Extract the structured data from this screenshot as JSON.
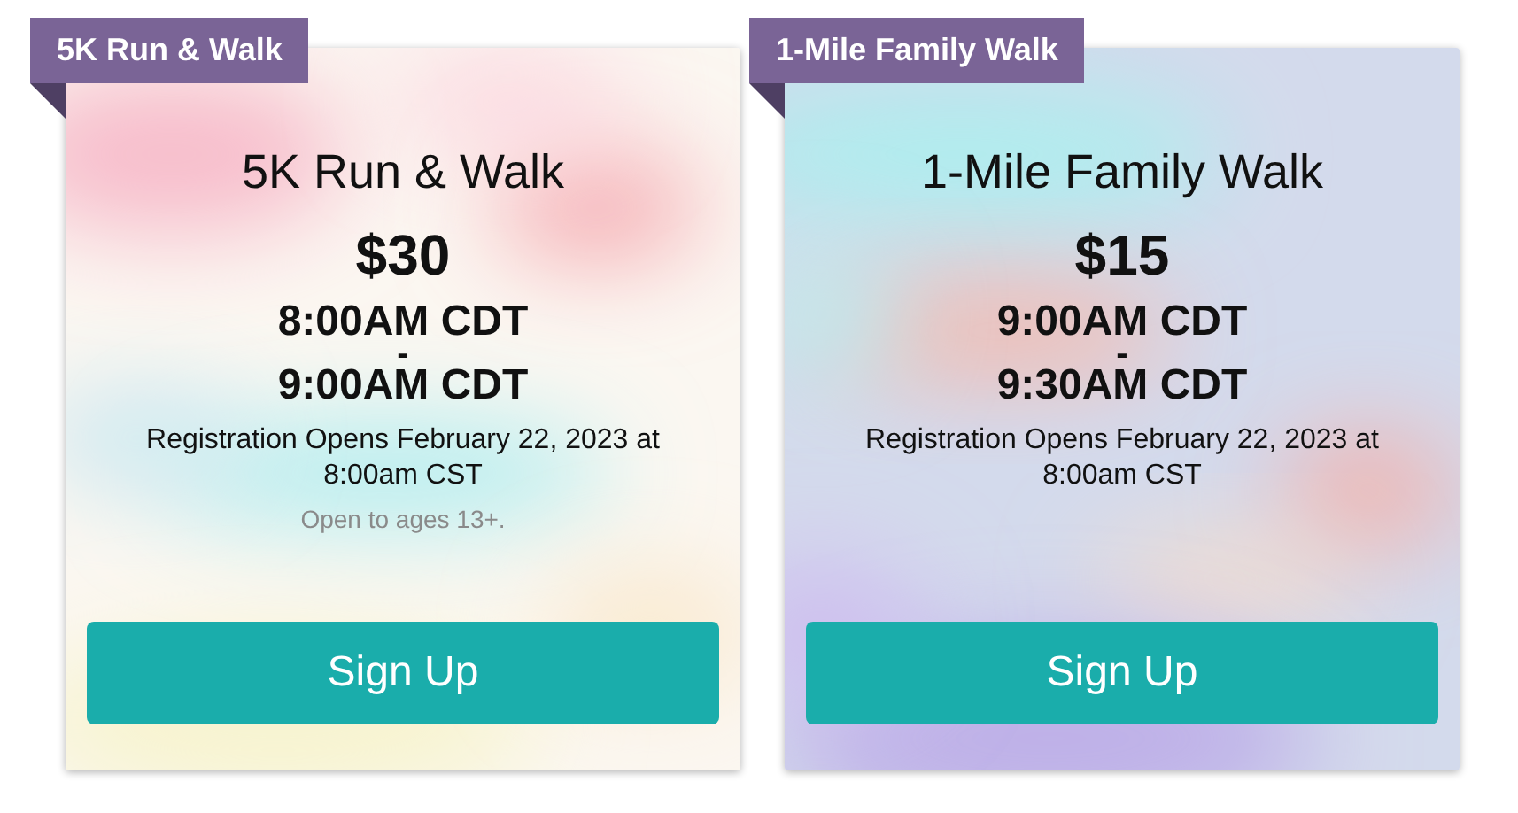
{
  "events": [
    {
      "tag": "5K Run & Walk",
      "title": "5K Run & Walk",
      "price": "$30",
      "start_time": "8:00AM CDT",
      "separator": "-",
      "end_time": "9:00AM CDT",
      "registration": "Registration Opens February 22, 2023 at 8:00am CST",
      "note": "Open to ages 13+.",
      "button": "Sign Up"
    },
    {
      "tag": "1-Mile Family Walk",
      "title": "1-Mile Family Walk",
      "price": "$15",
      "start_time": "9:00AM CDT",
      "separator": "-",
      "end_time": "9:30AM CDT",
      "registration": "Registration Opens February 22, 2023 at 8:00am CST",
      "button": "Sign Up"
    }
  ]
}
